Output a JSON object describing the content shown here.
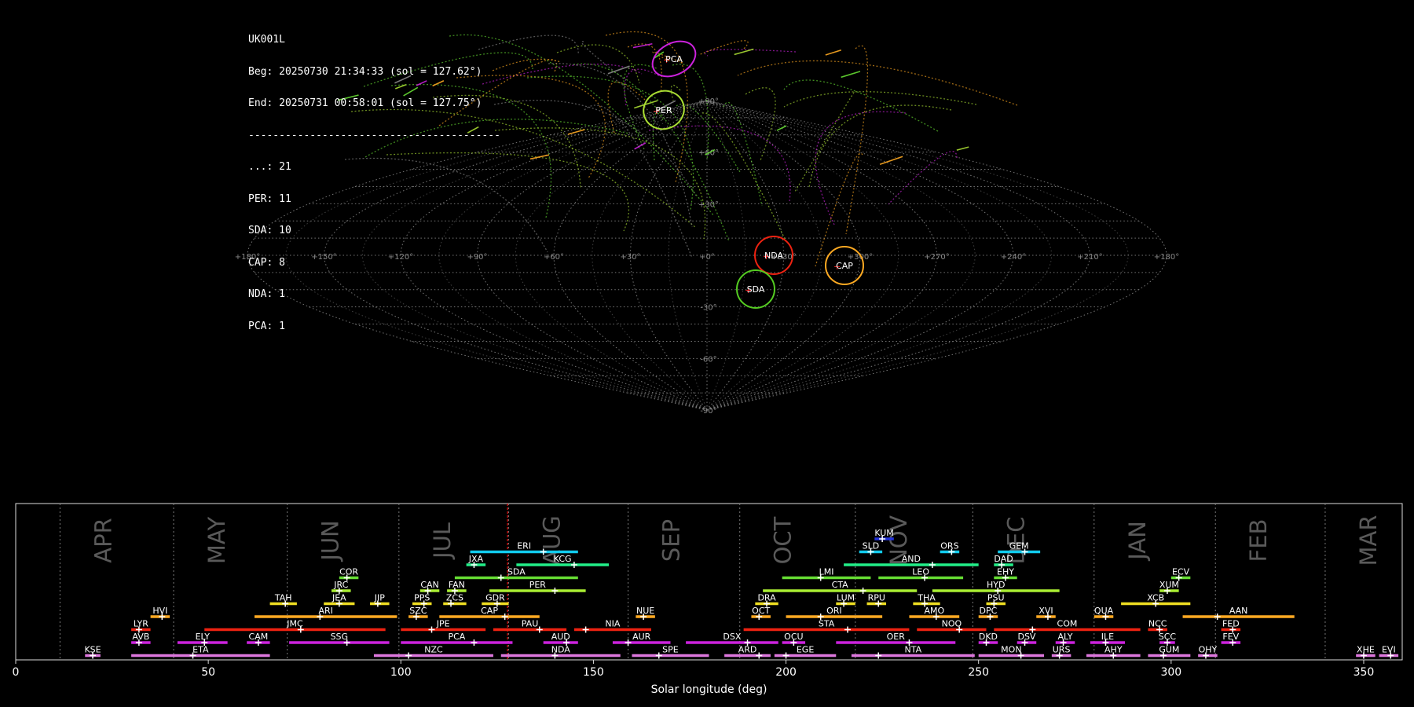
{
  "info": {
    "station": "UK001L",
    "begin": "Beg: 20250730 21:34:33 (sol = 127.62°)",
    "end": "End: 20250731 00:58:01 (sol = 127.75°)",
    "separator": "-----------------------------------------",
    "counts": [
      {
        "label": "...: 21"
      },
      {
        "label": "PER: 11"
      },
      {
        "label": "SDA: 10"
      },
      {
        "label": "CAP: 8"
      },
      {
        "label": "NDA: 1"
      },
      {
        "label": "PCA: 1"
      }
    ]
  },
  "sky_map": {
    "lon_ticks": [
      "+180°",
      "+150°",
      "+120°",
      "+90°",
      "+60°",
      "+30°",
      "+0°",
      "+330°",
      "+300°",
      "+270°",
      "+240°",
      "+210°",
      "+180°"
    ],
    "lat_ticks": [
      "+90°",
      "+60°",
      "+30°",
      "-30°",
      "-60°",
      "-90°"
    ],
    "radiants": [
      {
        "code": "PCA",
        "lon": 32,
        "lat": 68,
        "color": "#cc22dd"
      },
      {
        "code": "PER",
        "lon": 48,
        "lat": 57,
        "color": "#aadd33"
      },
      {
        "code": "NDA",
        "lon": 335,
        "lat": -1,
        "color": "#ee2211"
      },
      {
        "code": "CAP",
        "lon": 300,
        "lat": -4,
        "color": "#ffaa22"
      },
      {
        "code": "SDA",
        "lon": 340,
        "lat": -14,
        "color": "#55cc22"
      }
    ]
  },
  "chart_data": {
    "type": "bar",
    "xlabel": "Solar longitude (deg)",
    "xlim": [
      0,
      360
    ],
    "x_ticks": [
      0,
      50,
      100,
      150,
      200,
      250,
      300,
      350
    ],
    "current_sol": 127.7,
    "months": [
      {
        "name": "APR",
        "start": 11.5
      },
      {
        "name": "MAY",
        "start": 41
      },
      {
        "name": "JUN",
        "start": 70.5
      },
      {
        "name": "JUL",
        "start": 99.5
      },
      {
        "name": "AUG",
        "start": 128
      },
      {
        "name": "SEP",
        "start": 159
      },
      {
        "name": "OCT",
        "start": 188
      },
      {
        "name": "NOV",
        "start": 218
      },
      {
        "name": "DEC",
        "start": 248.5
      },
      {
        "name": "JAN",
        "start": 280
      },
      {
        "name": "FEB",
        "start": 311.5
      },
      {
        "name": "MAR",
        "start": 340
      }
    ],
    "showers": [
      {
        "code": "KUM",
        "start": 223,
        "end": 228,
        "peak": 225,
        "row": 0,
        "color": "#2233dd"
      },
      {
        "code": "ERI",
        "start": 118,
        "end": 146,
        "peak": 137,
        "row": 1,
        "color": "#11ccee"
      },
      {
        "code": "SLD",
        "start": 219,
        "end": 225,
        "peak": 222,
        "row": 1,
        "color": "#11ccee"
      },
      {
        "code": "ORS",
        "start": 240,
        "end": 245,
        "peak": 243,
        "row": 1,
        "color": "#11ccee"
      },
      {
        "code": "GEM",
        "start": 255,
        "end": 266,
        "peak": 262,
        "row": 1,
        "color": "#11ccee"
      },
      {
        "code": "JXA",
        "start": 117,
        "end": 122,
        "peak": 119,
        "row": 2,
        "color": "#22ee88"
      },
      {
        "code": "KCG",
        "start": 130,
        "end": 154,
        "peak": 145,
        "row": 2,
        "color": "#22ee88"
      },
      {
        "code": "AND",
        "start": 215,
        "end": 250,
        "peak": 238,
        "row": 2,
        "color": "#22ee88"
      },
      {
        "code": "DAD",
        "start": 254,
        "end": 259,
        "peak": 256,
        "row": 2,
        "color": "#22ee88"
      },
      {
        "code": "COR",
        "start": 84,
        "end": 89,
        "peak": 86,
        "row": 3,
        "color": "#66dd33"
      },
      {
        "code": "SDA",
        "start": 114,
        "end": 146,
        "peak": 126,
        "row": 3,
        "color": "#66dd33"
      },
      {
        "code": "LMI",
        "start": 199,
        "end": 222,
        "peak": 209,
        "row": 3,
        "color": "#66dd33"
      },
      {
        "code": "LEO",
        "start": 224,
        "end": 246,
        "peak": 236,
        "row": 3,
        "color": "#66dd33"
      },
      {
        "code": "EHY",
        "start": 254,
        "end": 260,
        "peak": 257,
        "row": 3,
        "color": "#66dd33"
      },
      {
        "code": "ECV",
        "start": 300,
        "end": 305,
        "peak": 302,
        "row": 3,
        "color": "#66dd33"
      },
      {
        "code": "JRC",
        "start": 82,
        "end": 87,
        "peak": 84,
        "row": 4,
        "color": "#aaee33"
      },
      {
        "code": "CAN",
        "start": 105,
        "end": 110,
        "peak": 107,
        "row": 4,
        "color": "#aaee33"
      },
      {
        "code": "FAN",
        "start": 112,
        "end": 117,
        "peak": 114,
        "row": 4,
        "color": "#aaee33"
      },
      {
        "code": "PER",
        "start": 123,
        "end": 148,
        "peak": 140,
        "row": 4,
        "color": "#aaee33"
      },
      {
        "code": "CTA",
        "start": 194,
        "end": 234,
        "peak": 220,
        "row": 4,
        "color": "#aaee33"
      },
      {
        "code": "HYD",
        "start": 238,
        "end": 271,
        "peak": 255,
        "row": 4,
        "color": "#aaee33"
      },
      {
        "code": "XUM",
        "start": 297,
        "end": 302,
        "peak": 299,
        "row": 4,
        "color": "#aaee33"
      },
      {
        "code": "TAH",
        "start": 66,
        "end": 73,
        "peak": 70,
        "row": 5,
        "color": "#eedd22"
      },
      {
        "code": "JEA",
        "start": 80,
        "end": 88,
        "peak": 84,
        "row": 5,
        "color": "#eedd22"
      },
      {
        "code": "JIP",
        "start": 92,
        "end": 97,
        "peak": 94,
        "row": 5,
        "color": "#eedd22"
      },
      {
        "code": "PPS",
        "start": 103,
        "end": 108,
        "peak": 106,
        "row": 5,
        "color": "#eedd22"
      },
      {
        "code": "ZCS",
        "start": 111,
        "end": 117,
        "peak": 113,
        "row": 5,
        "color": "#eedd22"
      },
      {
        "code": "GDR",
        "start": 121,
        "end": 128,
        "peak": 125,
        "row": 5,
        "color": "#eedd22"
      },
      {
        "code": "DRA",
        "start": 192,
        "end": 198,
        "peak": 195,
        "row": 5,
        "color": "#eedd22"
      },
      {
        "code": "LUM",
        "start": 213,
        "end": 218,
        "peak": 215,
        "row": 5,
        "color": "#eedd22"
      },
      {
        "code": "RPU",
        "start": 221,
        "end": 226,
        "peak": 224,
        "row": 5,
        "color": "#eedd22"
      },
      {
        "code": "THA",
        "start": 233,
        "end": 240,
        "peak": 236,
        "row": 5,
        "color": "#eedd22"
      },
      {
        "code": "PSU",
        "start": 252,
        "end": 257,
        "peak": 254,
        "row": 5,
        "color": "#eedd22"
      },
      {
        "code": "XCB",
        "start": 287,
        "end": 305,
        "peak": 296,
        "row": 5,
        "color": "#eedd22"
      },
      {
        "code": "HVI",
        "start": 35,
        "end": 40,
        "peak": 38,
        "row": 6,
        "color": "#ffaa22"
      },
      {
        "code": "ARI",
        "start": 62,
        "end": 99,
        "peak": 79,
        "row": 6,
        "color": "#ffaa22"
      },
      {
        "code": "SZC",
        "start": 102,
        "end": 107,
        "peak": 104,
        "row": 6,
        "color": "#ffaa22"
      },
      {
        "code": "CAP",
        "start": 110,
        "end": 136,
        "peak": 127,
        "row": 6,
        "color": "#ffaa22"
      },
      {
        "code": "NUE",
        "start": 161,
        "end": 166,
        "peak": 163,
        "row": 6,
        "color": "#ffaa22"
      },
      {
        "code": "OCT",
        "start": 191,
        "end": 196,
        "peak": 193,
        "row": 6,
        "color": "#ffaa22"
      },
      {
        "code": "ORI",
        "start": 200,
        "end": 225,
        "peak": 209,
        "row": 6,
        "color": "#ffaa22"
      },
      {
        "code": "AMO",
        "start": 232,
        "end": 245,
        "peak": 239,
        "row": 6,
        "color": "#ffaa22"
      },
      {
        "code": "DPC",
        "start": 250,
        "end": 255,
        "peak": 253,
        "row": 6,
        "color": "#ffaa22"
      },
      {
        "code": "XVI",
        "start": 265,
        "end": 270,
        "peak": 268,
        "row": 6,
        "color": "#ffaa22"
      },
      {
        "code": "QUA",
        "start": 280,
        "end": 285,
        "peak": 283,
        "row": 6,
        "color": "#ffaa22"
      },
      {
        "code": "AAN",
        "start": 303,
        "end": 332,
        "peak": 312,
        "row": 6,
        "color": "#ffaa22"
      },
      {
        "code": "LYR",
        "start": 30,
        "end": 35,
        "peak": 32,
        "row": 7,
        "color": "#ee2211"
      },
      {
        "code": "JMC",
        "start": 49,
        "end": 96,
        "peak": 74,
        "row": 7,
        "color": "#ee2211"
      },
      {
        "code": "JPE",
        "start": 100,
        "end": 122,
        "peak": 108,
        "row": 7,
        "color": "#ee2211"
      },
      {
        "code": "PAU",
        "start": 124,
        "end": 143,
        "peak": 136,
        "row": 7,
        "color": "#ee2211"
      },
      {
        "code": "NIA",
        "start": 145,
        "end": 165,
        "peak": 148,
        "row": 7,
        "color": "#ee2211"
      },
      {
        "code": "STA",
        "start": 189,
        "end": 232,
        "peak": 216,
        "row": 7,
        "color": "#ee2211"
      },
      {
        "code": "NOO",
        "start": 234,
        "end": 252,
        "peak": 245,
        "row": 7,
        "color": "#ee2211"
      },
      {
        "code": "COM",
        "start": 254,
        "end": 292,
        "peak": 264,
        "row": 7,
        "color": "#ee2211"
      },
      {
        "code": "NCC",
        "start": 294,
        "end": 299,
        "peak": 297,
        "row": 7,
        "color": "#ee2211"
      },
      {
        "code": "FED",
        "start": 313,
        "end": 318,
        "peak": 316,
        "row": 7,
        "color": "#ee2211"
      },
      {
        "code": "AVB",
        "start": 30,
        "end": 35,
        "peak": 32,
        "row": 8,
        "color": "#cc22dd"
      },
      {
        "code": "ELY",
        "start": 42,
        "end": 55,
        "peak": 49,
        "row": 8,
        "color": "#cc22dd"
      },
      {
        "code": "CAM",
        "start": 60,
        "end": 66,
        "peak": 63,
        "row": 8,
        "color": "#cc22dd"
      },
      {
        "code": "SSG",
        "start": 71,
        "end": 97,
        "peak": 86,
        "row": 8,
        "color": "#cc22dd"
      },
      {
        "code": "PCA",
        "start": 100,
        "end": 129,
        "peak": 119,
        "row": 8,
        "color": "#cc22dd"
      },
      {
        "code": "AUD",
        "start": 137,
        "end": 146,
        "peak": 143,
        "row": 8,
        "color": "#cc22dd"
      },
      {
        "code": "AUR",
        "start": 155,
        "end": 170,
        "peak": 159,
        "row": 8,
        "color": "#cc22dd"
      },
      {
        "code": "DSX",
        "start": 174,
        "end": 198,
        "peak": 190,
        "row": 8,
        "color": "#cc22dd"
      },
      {
        "code": "OCU",
        "start": 199,
        "end": 205,
        "peak": 202,
        "row": 8,
        "color": "#cc22dd"
      },
      {
        "code": "OER",
        "start": 213,
        "end": 244,
        "peak": 232,
        "row": 8,
        "color": "#cc22dd"
      },
      {
        "code": "DKD",
        "start": 250,
        "end": 255,
        "peak": 252,
        "row": 8,
        "color": "#cc22dd"
      },
      {
        "code": "DSV",
        "start": 260,
        "end": 265,
        "peak": 262,
        "row": 8,
        "color": "#cc22dd"
      },
      {
        "code": "ALY",
        "start": 270,
        "end": 275,
        "peak": 272,
        "row": 8,
        "color": "#cc22dd"
      },
      {
        "code": "ILE",
        "start": 279,
        "end": 288,
        "peak": 283,
        "row": 8,
        "color": "#cc22dd"
      },
      {
        "code": "SCC",
        "start": 297,
        "end": 301,
        "peak": 299,
        "row": 8,
        "color": "#cc22dd"
      },
      {
        "code": "FEV",
        "start": 313,
        "end": 318,
        "peak": 316,
        "row": 8,
        "color": "#cc22dd"
      },
      {
        "code": "KSE",
        "start": 18,
        "end": 22,
        "peak": 20,
        "row": 9,
        "color": "#dd77dd"
      },
      {
        "code": "ETA",
        "start": 30,
        "end": 66,
        "peak": 46,
        "row": 9,
        "color": "#dd77dd"
      },
      {
        "code": "NZC",
        "start": 93,
        "end": 124,
        "peak": 102,
        "row": 9,
        "color": "#dd77dd"
      },
      {
        "code": "NDA",
        "start": 126,
        "end": 157,
        "peak": 140,
        "row": 9,
        "color": "#dd77dd"
      },
      {
        "code": "SPE",
        "start": 160,
        "end": 180,
        "peak": 167,
        "row": 9,
        "color": "#dd77dd"
      },
      {
        "code": "ARD",
        "start": 184,
        "end": 196,
        "peak": 193,
        "row": 9,
        "color": "#dd77dd"
      },
      {
        "code": "EGE",
        "start": 197,
        "end": 213,
        "peak": 200,
        "row": 9,
        "color": "#dd77dd"
      },
      {
        "code": "NTA",
        "start": 217,
        "end": 249,
        "peak": 224,
        "row": 9,
        "color": "#dd77dd"
      },
      {
        "code": "MON",
        "start": 250,
        "end": 267,
        "peak": 261,
        "row": 9,
        "color": "#dd77dd"
      },
      {
        "code": "URS",
        "start": 269,
        "end": 274,
        "peak": 271,
        "row": 9,
        "color": "#dd77dd"
      },
      {
        "code": "AHY",
        "start": 278,
        "end": 292,
        "peak": 285,
        "row": 9,
        "color": "#dd77dd"
      },
      {
        "code": "GUM",
        "start": 294,
        "end": 305,
        "peak": 298,
        "row": 9,
        "color": "#dd77dd"
      },
      {
        "code": "OHY",
        "start": 307,
        "end": 312,
        "peak": 309,
        "row": 9,
        "color": "#dd77dd"
      },
      {
        "code": "XHE",
        "start": 348,
        "end": 353,
        "peak": 350,
        "row": 9,
        "color": "#dd77dd"
      },
      {
        "code": "EVI",
        "start": 354,
        "end": 359,
        "peak": 357,
        "row": 9,
        "color": "#dd77dd"
      }
    ]
  }
}
